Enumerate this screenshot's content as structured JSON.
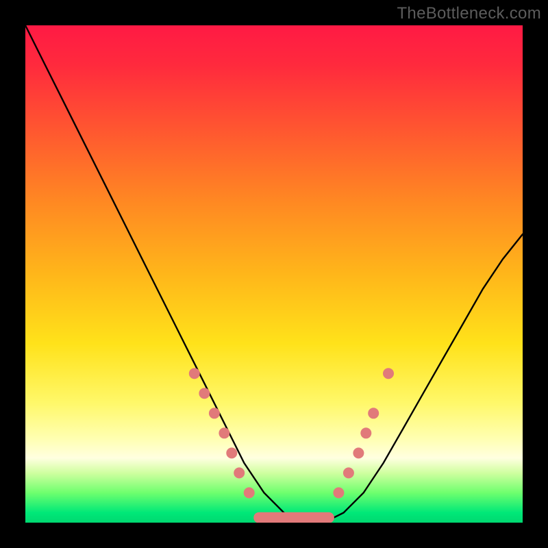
{
  "watermark": "TheBottleneck.com",
  "chart_data": {
    "type": "line",
    "title": "",
    "xlabel": "",
    "ylabel": "",
    "xlim": [
      0,
      100
    ],
    "ylim": [
      0,
      100
    ],
    "grid": false,
    "series": [
      {
        "name": "bottleneck-curve",
        "color": "#000000",
        "x": [
          0,
          4,
          8,
          12,
          16,
          20,
          24,
          28,
          32,
          36,
          40,
          44,
          48,
          52,
          56,
          60,
          64,
          68,
          72,
          76,
          80,
          84,
          88,
          92,
          96,
          100
        ],
        "y": [
          100,
          92,
          84,
          76,
          68,
          60,
          52,
          44,
          36,
          28,
          20,
          12,
          6,
          2,
          0,
          0,
          2,
          6,
          12,
          19,
          26,
          33,
          40,
          47,
          53,
          58
        ]
      }
    ],
    "markers": {
      "name": "highlight-dots",
      "color": "#e17a7a",
      "points": [
        {
          "x": 34,
          "y": 30
        },
        {
          "x": 36,
          "y": 26
        },
        {
          "x": 38,
          "y": 22
        },
        {
          "x": 40,
          "y": 18
        },
        {
          "x": 41.5,
          "y": 14
        },
        {
          "x": 43,
          "y": 10
        },
        {
          "x": 45,
          "y": 6
        },
        {
          "x": 63,
          "y": 6
        },
        {
          "x": 65,
          "y": 10
        },
        {
          "x": 67,
          "y": 14
        },
        {
          "x": 68.5,
          "y": 18
        },
        {
          "x": 70,
          "y": 22
        },
        {
          "x": 73,
          "y": 30
        }
      ]
    },
    "flat_band": {
      "x_start": 47,
      "x_end": 61,
      "y": 1,
      "color": "#e17a7a"
    }
  }
}
